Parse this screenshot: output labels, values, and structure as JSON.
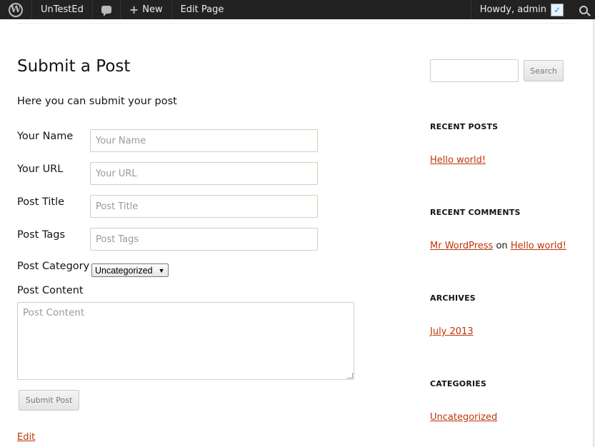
{
  "adminbar": {
    "site_name": "UnTestEd",
    "new_label": "New",
    "edit_page_label": "Edit Page",
    "howdy": "Howdy, admin"
  },
  "main": {
    "title": "Submit a Post",
    "intro": "Here you can submit your post",
    "fields": [
      {
        "label": "Your Name",
        "placeholder": "Your Name"
      },
      {
        "label": "Your URL",
        "placeholder": "Your URL"
      },
      {
        "label": "Post Title",
        "placeholder": "Post Title"
      },
      {
        "label": "Post Tags",
        "placeholder": "Post Tags"
      }
    ],
    "category_label": "Post Category",
    "category_value": "Uncategorized",
    "content_label": "Post Content",
    "content_placeholder": "Post Content",
    "submit_label": "Submit Post",
    "edit_label": "Edit"
  },
  "sidebar": {
    "search_button": "Search",
    "recent_posts": {
      "title": "Recent Posts",
      "items": [
        "Hello world!"
      ]
    },
    "recent_comments": {
      "title": "Recent Comments",
      "author": "Mr WordPress",
      "connector": "on",
      "post": "Hello world!"
    },
    "archives": {
      "title": "Archives",
      "items": [
        "July 2013"
      ]
    },
    "categories": {
      "title": "Categories",
      "items": [
        "Uncategorized"
      ]
    }
  },
  "colors": {
    "link": "#bc360a",
    "adminbar": "#222222"
  }
}
